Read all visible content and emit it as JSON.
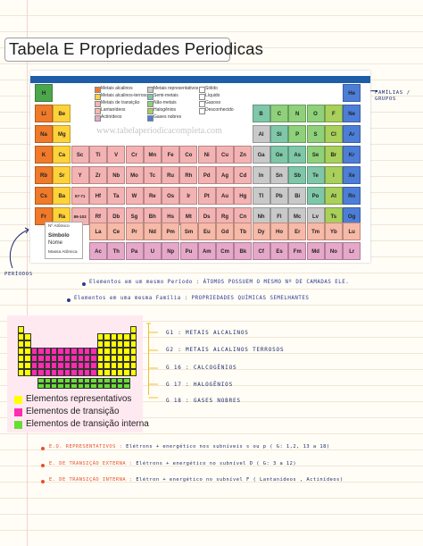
{
  "title": "Tabela E Propriedades Periodicas",
  "side_label": "FAMÍLIAS / GRUPOS",
  "left_label": "PERÍODOS",
  "watermark": "www.tabelaperiodicacompleta.com",
  "legend": {
    "atomic_number": "Nº Atômico",
    "symbol": "Símbolo",
    "name": "Nome",
    "mass": "Massa Atômica"
  },
  "category_legend": [
    "Metais alcalinos",
    "Metais alcalinos-terrosos",
    "Metais de transição",
    "Lantanídeos",
    "Actinídeos",
    "Metais representativos",
    "Semi-metais",
    "Não-metais",
    "Halogênios",
    "Gases nobres",
    "Sólido",
    "Líquido",
    "Gasoso",
    "Desconhecido"
  ],
  "notes": {
    "period": "Elementos em um mesmo Período : ÁTOMOS POSSUEM O MESMO Nº DE CAMADAS ELE.",
    "family": "Elementos em uma mesma Família : PROPRIEDADES QUÍMICAS SEMELHANTES"
  },
  "groups": [
    "G1 : METAIS ALCALINOS",
    "G2 : METAIS ALCALINOS TERROSOS",
    "G 16 : CALCOGÊNIOS",
    "G 17 : HALOGÊNIOS",
    "G 18 : GASES NOBRES"
  ],
  "mini_legend": [
    "Elementos representativos",
    "Elementos de transição",
    "Elementos de transição interna"
  ],
  "colors": {
    "representative": "#ffff00",
    "transition": "#ff2bb0",
    "inner": "#66dd33"
  },
  "config": [
    {
      "label": "E.Q. REPRESENTATIVOS :",
      "text": "Elétrons + energético nos subníveis s ou p  ( G: 1,2, 13 a 18)",
      "color": "#e8502a"
    },
    {
      "label": "E. DE TRANSIÇÃO EXTERNA :",
      "text": "Elétrons + energético no subnível D  ( G: 3 a 12)",
      "color": "#e8502a"
    },
    {
      "label": "E. DE TRANSIÇÃO INTERNA :",
      "text": "Elétron + energético no subnível F  ( Lantanídeos , Actinídeos)",
      "color": "#e8502a"
    }
  ],
  "elements": [
    {
      "s": "H",
      "p": 1,
      "g": 1
    },
    {
      "s": "He",
      "p": 1,
      "g": 18
    },
    {
      "s": "Li",
      "p": 2,
      "g": 1
    },
    {
      "s": "Be",
      "p": 2,
      "g": 2
    },
    {
      "s": "B",
      "p": 2,
      "g": 13
    },
    {
      "s": "C",
      "p": 2,
      "g": 14
    },
    {
      "s": "N",
      "p": 2,
      "g": 15
    },
    {
      "s": "O",
      "p": 2,
      "g": 16
    },
    {
      "s": "F",
      "p": 2,
      "g": 17
    },
    {
      "s": "Ne",
      "p": 2,
      "g": 18
    },
    {
      "s": "Na",
      "p": 3,
      "g": 1
    },
    {
      "s": "Mg",
      "p": 3,
      "g": 2
    },
    {
      "s": "Al",
      "p": 3,
      "g": 13
    },
    {
      "s": "Si",
      "p": 3,
      "g": 14
    },
    {
      "s": "P",
      "p": 3,
      "g": 15
    },
    {
      "s": "S",
      "p": 3,
      "g": 16
    },
    {
      "s": "Cl",
      "p": 3,
      "g": 17
    },
    {
      "s": "Ar",
      "p": 3,
      "g": 18
    },
    {
      "s": "K",
      "p": 4,
      "g": 1
    },
    {
      "s": "Ca",
      "p": 4,
      "g": 2
    },
    {
      "s": "Sc",
      "p": 4,
      "g": 3
    },
    {
      "s": "Ti",
      "p": 4,
      "g": 4
    },
    {
      "s": "V",
      "p": 4,
      "g": 5
    },
    {
      "s": "Cr",
      "p": 4,
      "g": 6
    },
    {
      "s": "Mn",
      "p": 4,
      "g": 7
    },
    {
      "s": "Fe",
      "p": 4,
      "g": 8
    },
    {
      "s": "Co",
      "p": 4,
      "g": 9
    },
    {
      "s": "Ni",
      "p": 4,
      "g": 10
    },
    {
      "s": "Cu",
      "p": 4,
      "g": 11
    },
    {
      "s": "Zn",
      "p": 4,
      "g": 12
    },
    {
      "s": "Ga",
      "p": 4,
      "g": 13
    },
    {
      "s": "Ge",
      "p": 4,
      "g": 14
    },
    {
      "s": "As",
      "p": 4,
      "g": 15
    },
    {
      "s": "Se",
      "p": 4,
      "g": 16
    },
    {
      "s": "Br",
      "p": 4,
      "g": 17
    },
    {
      "s": "Kr",
      "p": 4,
      "g": 18
    },
    {
      "s": "Rb",
      "p": 5,
      "g": 1
    },
    {
      "s": "Sr",
      "p": 5,
      "g": 2
    },
    {
      "s": "Y",
      "p": 5,
      "g": 3
    },
    {
      "s": "Zr",
      "p": 5,
      "g": 4
    },
    {
      "s": "Nb",
      "p": 5,
      "g": 5
    },
    {
      "s": "Mo",
      "p": 5,
      "g": 6
    },
    {
      "s": "Tc",
      "p": 5,
      "g": 7
    },
    {
      "s": "Ru",
      "p": 5,
      "g": 8
    },
    {
      "s": "Rh",
      "p": 5,
      "g": 9
    },
    {
      "s": "Pd",
      "p": 5,
      "g": 10
    },
    {
      "s": "Ag",
      "p": 5,
      "g": 11
    },
    {
      "s": "Cd",
      "p": 5,
      "g": 12
    },
    {
      "s": "In",
      "p": 5,
      "g": 13
    },
    {
      "s": "Sn",
      "p": 5,
      "g": 14
    },
    {
      "s": "Sb",
      "p": 5,
      "g": 15
    },
    {
      "s": "Te",
      "p": 5,
      "g": 16
    },
    {
      "s": "I",
      "p": 5,
      "g": 17
    },
    {
      "s": "Xe",
      "p": 5,
      "g": 18
    },
    {
      "s": "Cs",
      "p": 6,
      "g": 1
    },
    {
      "s": "Ba",
      "p": 6,
      "g": 2
    },
    {
      "s": "57-71",
      "p": 6,
      "g": 3
    },
    {
      "s": "Hf",
      "p": 6,
      "g": 4
    },
    {
      "s": "Ta",
      "p": 6,
      "g": 5
    },
    {
      "s": "W",
      "p": 6,
      "g": 6
    },
    {
      "s": "Re",
      "p": 6,
      "g": 7
    },
    {
      "s": "Os",
      "p": 6,
      "g": 8
    },
    {
      "s": "Ir",
      "p": 6,
      "g": 9
    },
    {
      "s": "Pt",
      "p": 6,
      "g": 10
    },
    {
      "s": "Au",
      "p": 6,
      "g": 11
    },
    {
      "s": "Hg",
      "p": 6,
      "g": 12
    },
    {
      "s": "Tl",
      "p": 6,
      "g": 13
    },
    {
      "s": "Pb",
      "p": 6,
      "g": 14
    },
    {
      "s": "Bi",
      "p": 6,
      "g": 15
    },
    {
      "s": "Po",
      "p": 6,
      "g": 16
    },
    {
      "s": "At",
      "p": 6,
      "g": 17
    },
    {
      "s": "Rn",
      "p": 6,
      "g": 18
    },
    {
      "s": "Fr",
      "p": 7,
      "g": 1
    },
    {
      "s": "Ra",
      "p": 7,
      "g": 2
    },
    {
      "s": "89-103",
      "p": 7,
      "g": 3
    },
    {
      "s": "Rf",
      "p": 7,
      "g": 4
    },
    {
      "s": "Db",
      "p": 7,
      "g": 5
    },
    {
      "s": "Sg",
      "p": 7,
      "g": 6
    },
    {
      "s": "Bh",
      "p": 7,
      "g": 7
    },
    {
      "s": "Hs",
      "p": 7,
      "g": 8
    },
    {
      "s": "Mt",
      "p": 7,
      "g": 9
    },
    {
      "s": "Ds",
      "p": 7,
      "g": 10
    },
    {
      "s": "Rg",
      "p": 7,
      "g": 11
    },
    {
      "s": "Cn",
      "p": 7,
      "g": 12
    },
    {
      "s": "Nh",
      "p": 7,
      "g": 13
    },
    {
      "s": "Fl",
      "p": 7,
      "g": 14
    },
    {
      "s": "Mc",
      "p": 7,
      "g": 15
    },
    {
      "s": "Lv",
      "p": 7,
      "g": 16
    },
    {
      "s": "Ts",
      "p": 7,
      "g": 17
    },
    {
      "s": "Og",
      "p": 7,
      "g": 18
    }
  ],
  "lanthanides": [
    "La",
    "Ce",
    "Pr",
    "Nd",
    "Pm",
    "Sm",
    "Eu",
    "Gd",
    "Tb",
    "Dy",
    "Ho",
    "Er",
    "Tm",
    "Yb",
    "Lu"
  ],
  "actinides": [
    "Ac",
    "Th",
    "Pa",
    "U",
    "Np",
    "Pu",
    "Am",
    "Cm",
    "Bk",
    "Cf",
    "Es",
    "Fm",
    "Md",
    "No",
    "Lr"
  ]
}
